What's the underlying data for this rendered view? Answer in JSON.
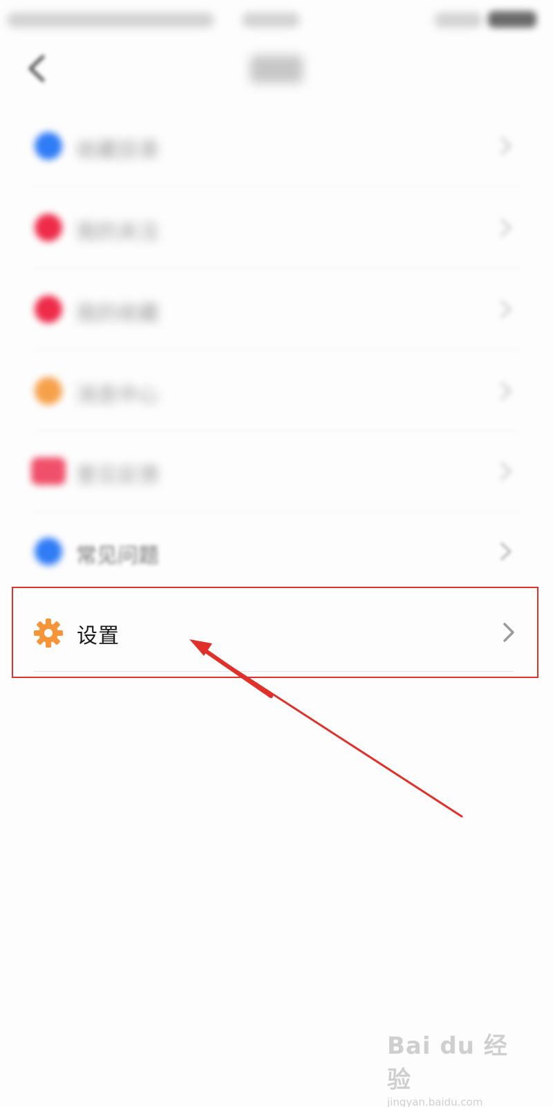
{
  "status_bar": {
    "colors": {
      "text_blur": "#c8c8c8",
      "battery": "#6a6a6a"
    }
  },
  "nav": {
    "back_icon": "chevron-left-icon",
    "title": "更多"
  },
  "menu": {
    "items": [
      {
        "label": "收藏目录",
        "icon": "blue-dot-icon",
        "icon_color": "#2f7cf6",
        "blurred": true
      },
      {
        "label": "我的关注",
        "icon": "red-heart-icon",
        "icon_color": "#ee2b49",
        "blurred": true
      },
      {
        "label": "我的收藏",
        "icon": "red-star-icon",
        "icon_color": "#ee2b49",
        "blurred": true
      },
      {
        "label": "消息中心",
        "icon": "orange-bell-icon",
        "icon_color": "#f6a14a",
        "blurred": true
      },
      {
        "label": "意见反馈",
        "icon": "red-message-icon",
        "icon_color": "#f0506a",
        "blurred": true
      },
      {
        "label": "常见问题",
        "icon": "blue-help-icon",
        "icon_color": "#2f7cf6",
        "blurred": true
      }
    ],
    "settings": {
      "label": "设置",
      "icon": "gear-icon",
      "icon_color": "#f59538"
    }
  },
  "annotation": {
    "highlight_color": "#e0302a",
    "arrow_color": "#e0302a"
  },
  "watermark": {
    "logo": "Bai du 经验",
    "url": "jingyan.baidu.com"
  }
}
